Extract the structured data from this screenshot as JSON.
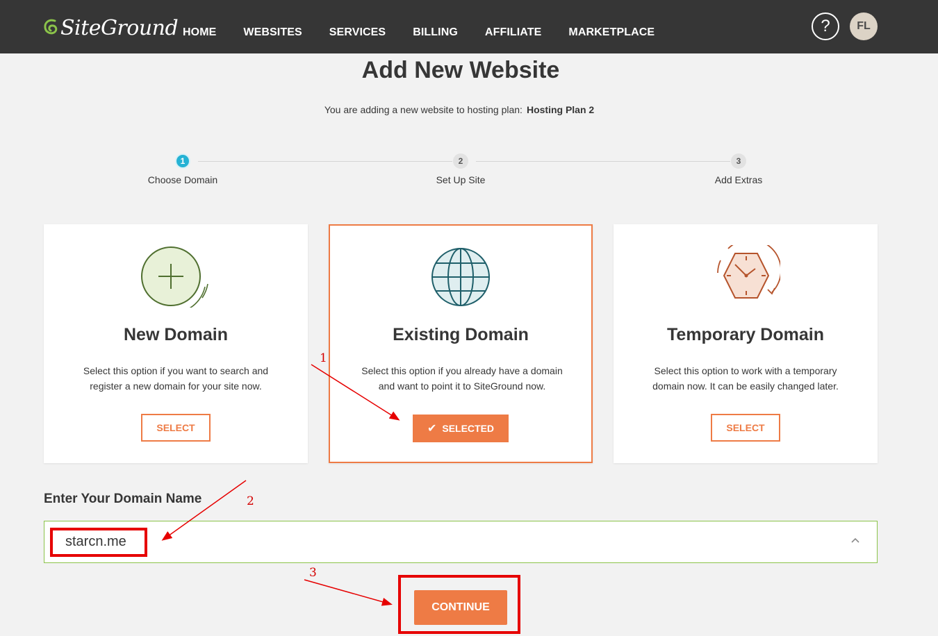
{
  "header": {
    "logo_text": "SiteGround",
    "nav": [
      "HOME",
      "WEBSITES",
      "SERVICES",
      "BILLING",
      "AFFILIATE",
      "MARKETPLACE"
    ],
    "help_label": "?",
    "avatar_initials": "FL"
  },
  "page": {
    "title": "Add New Website",
    "subtitle_prefix": "You are adding a new website to hosting plan:",
    "plan_name": "Hosting Plan 2"
  },
  "steps": [
    {
      "number": "1",
      "label": "Choose Domain",
      "active": true
    },
    {
      "number": "2",
      "label": "Set Up Site",
      "active": false
    },
    {
      "number": "3",
      "label": "Add Extras",
      "active": false
    }
  ],
  "cards": [
    {
      "icon": "plus-circle-icon",
      "title": "New Domain",
      "description": "Select this option if you want to search and register a new domain for your site now.",
      "button": "SELECT",
      "selected": false
    },
    {
      "icon": "globe-icon",
      "title": "Existing Domain",
      "description": "Select this option if you already have a domain and want to point it to SiteGround now.",
      "button": "SELECTED",
      "selected": true
    },
    {
      "icon": "clock-icon",
      "title": "Temporary Domain",
      "description": "Select this option to work with a temporary domain now. It can be easily changed later.",
      "button": "SELECT",
      "selected": false
    }
  ],
  "domain_field": {
    "label": "Enter Your Domain Name",
    "value": "starcn.me"
  },
  "continue_label": "CONTINUE",
  "annotations": [
    "1",
    "2",
    "3"
  ],
  "colors": {
    "header_bg": "#363636",
    "accent": "#ee7b45",
    "step_active": "#25b2d4",
    "logo_green": "#8bc34a",
    "annotation_red": "#e60000"
  }
}
